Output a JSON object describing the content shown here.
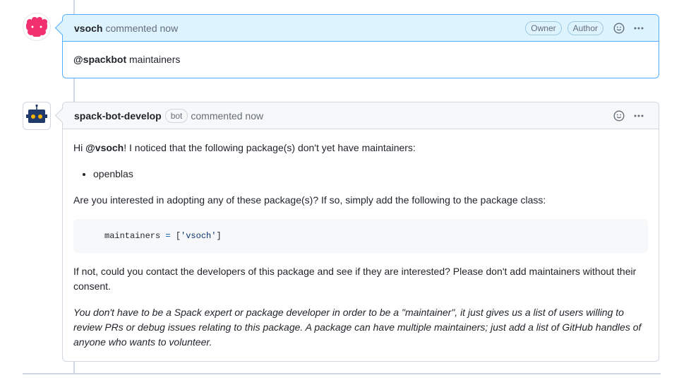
{
  "comments": [
    {
      "author": "vsoch",
      "meta": "commented now",
      "badges": [
        "Owner",
        "Author"
      ],
      "body": {
        "mention": "@spackbot",
        "text": " maintainers"
      }
    },
    {
      "author": "spack-bot-develop",
      "bot_badge": "bot",
      "meta": "commented now",
      "body": {
        "greeting_prefix": "Hi ",
        "greeting_mention": "@vsoch",
        "greeting_suffix": "! I noticed that the following package(s) don't yet have maintainers:",
        "packages": [
          "openblas"
        ],
        "question": "Are you interested in adopting any of these package(s)? If so, simply add the following to the package class:",
        "code": {
          "name": "maintainers",
          "op": " = ",
          "open": "[",
          "value": "'vsoch'",
          "close": "]"
        },
        "followup": "If not, could you contact the developers of this package and see if they are interested? Please don't add maintainers without their consent.",
        "note": "You don't have to be a Spack expert or package developer in order to be a \"maintainer\", it just gives us a list of users willing to review PRs or debug issues relating to this package. A package can have multiple maintainers; just add a list of GitHub handles of anyone who wants to volunteer."
      }
    }
  ],
  "icons": [
    "reaction-smiley-icon",
    "kebab-menu-icon"
  ],
  "colors": {
    "owner_header_bg": "#ddf4ff",
    "owner_border": "#54aeff",
    "header_bg": "#f6f8fa",
    "avatar_pink": "#f0316e",
    "bot_blue": "#1f3a6b",
    "bot_yellow": "#f5b400"
  }
}
